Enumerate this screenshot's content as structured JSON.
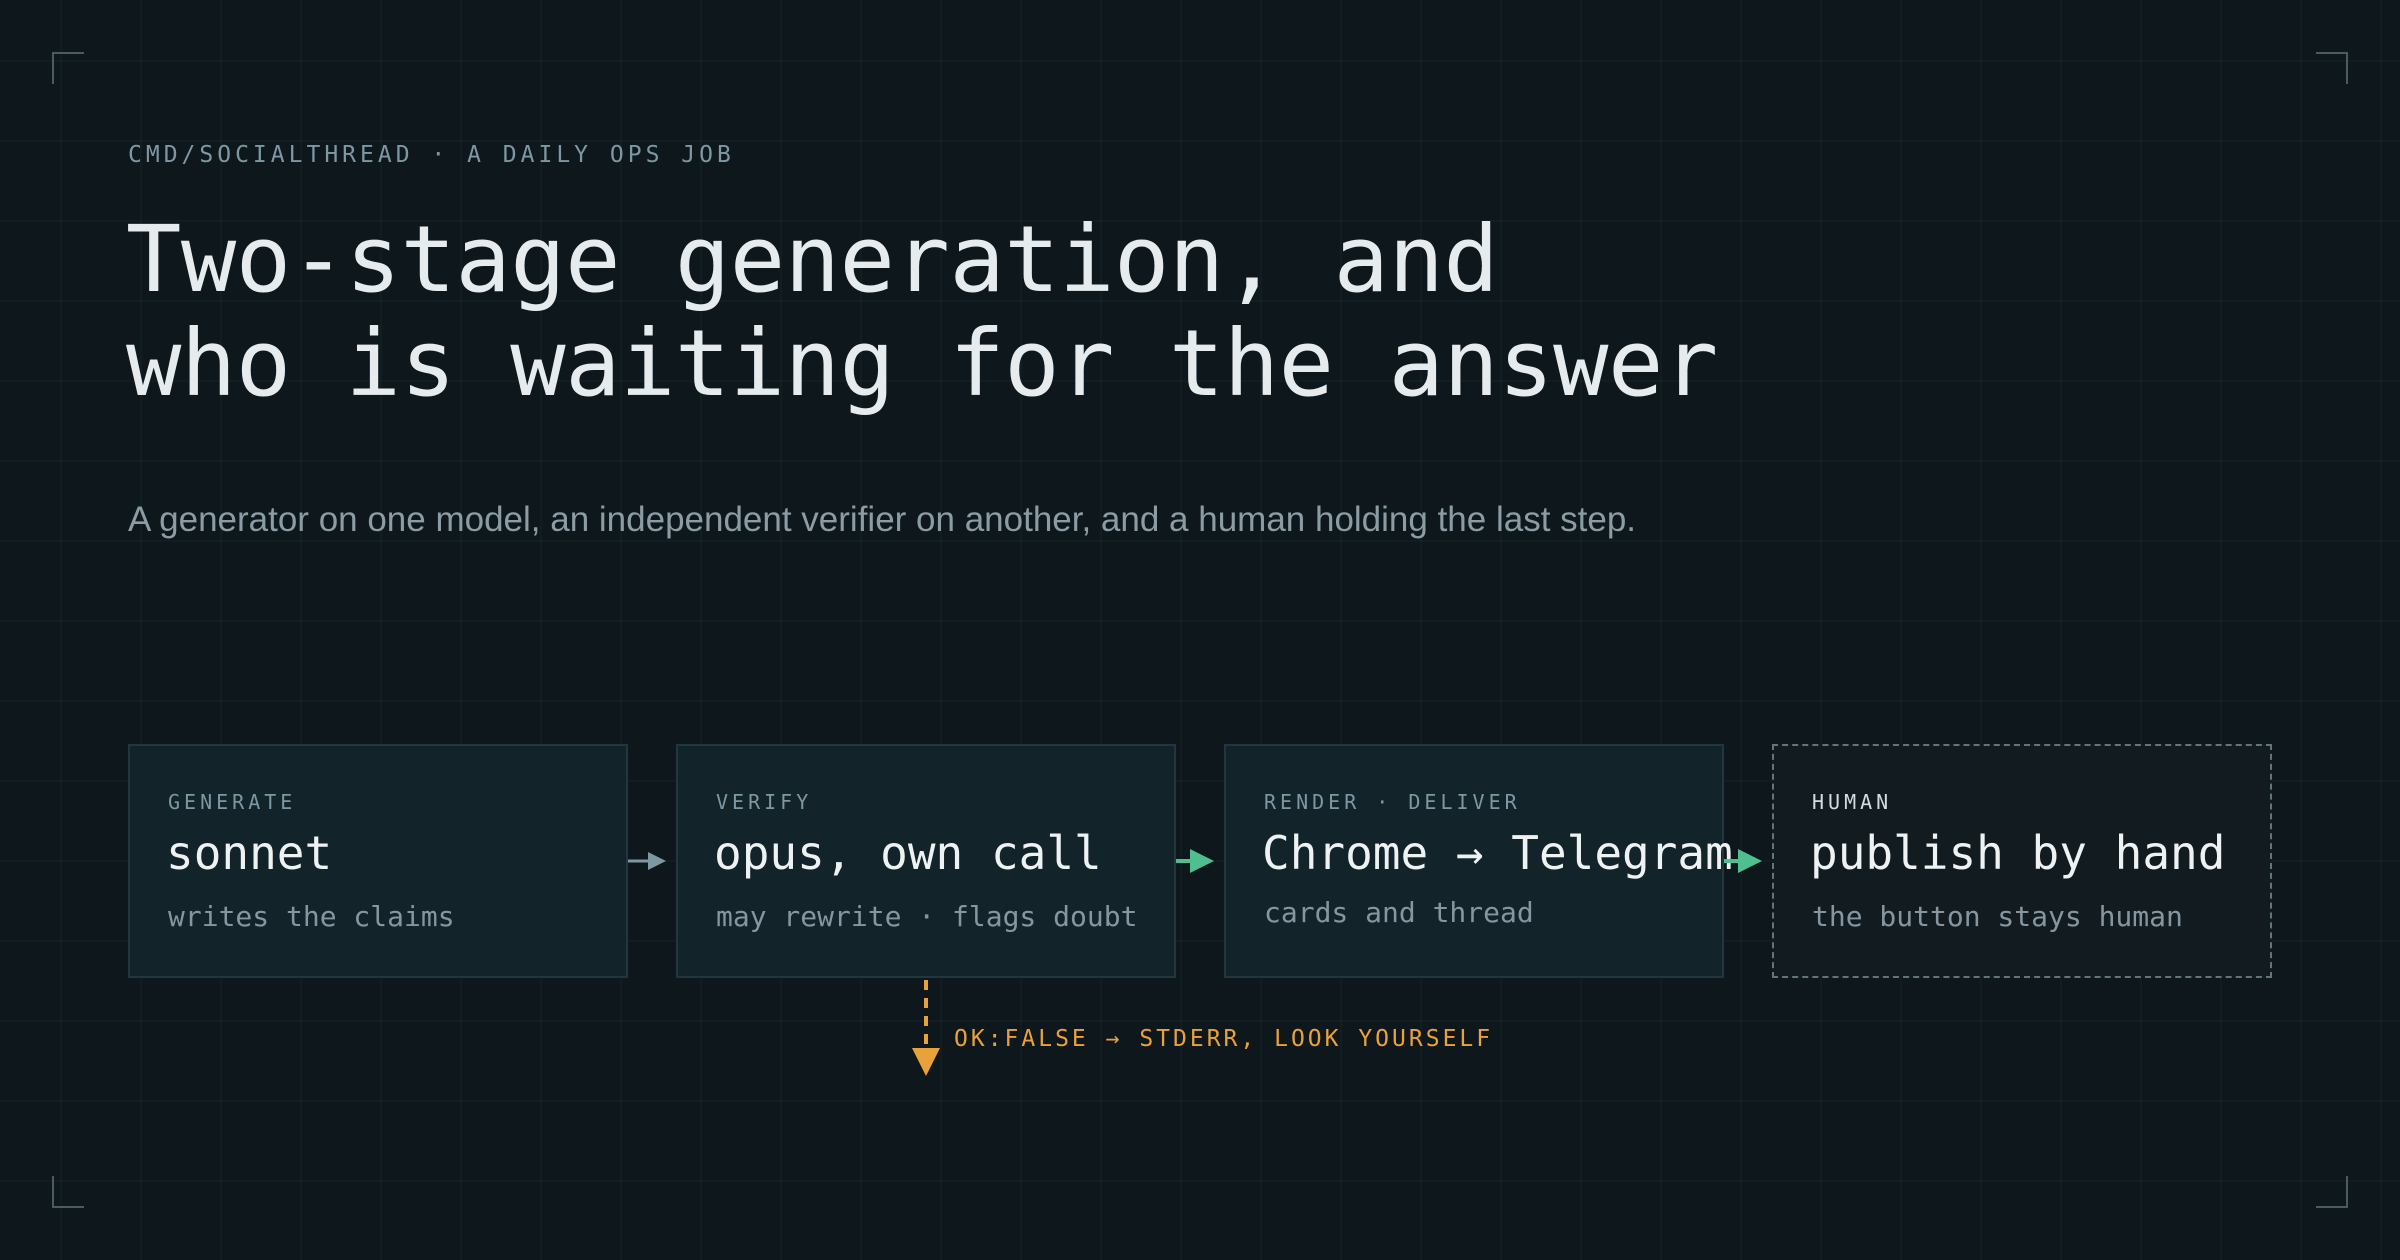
{
  "eyebrow": "CMD/SOCIALTHREAD · A DAILY OPS JOB",
  "headline": {
    "line1": "Two-stage generation, and",
    "line2": "who is waiting for the answer"
  },
  "subtitle": "A generator on one model, an independent verifier on another, and a human holding the last step.",
  "stages": [
    {
      "tag": "GENERATE",
      "title": "sonnet",
      "desc": "writes the claims"
    },
    {
      "tag": "VERIFY",
      "title": "opus, own call",
      "desc": "may rewrite · flags doubt"
    },
    {
      "tag": "RENDER · DELIVER",
      "title": "Chrome → Telegram",
      "desc": "cards and thread"
    },
    {
      "tag": "HUMAN",
      "title": "publish by hand",
      "desc": "the button stays human"
    }
  ],
  "failure_branch": "OK:FALSE → STDERR, LOOK YOURSELF",
  "colors": {
    "background": "#0e171b",
    "arrow_neutral": "#7d98a3",
    "arrow_green": "#4fbf8f",
    "warning": "#e9a23b"
  }
}
